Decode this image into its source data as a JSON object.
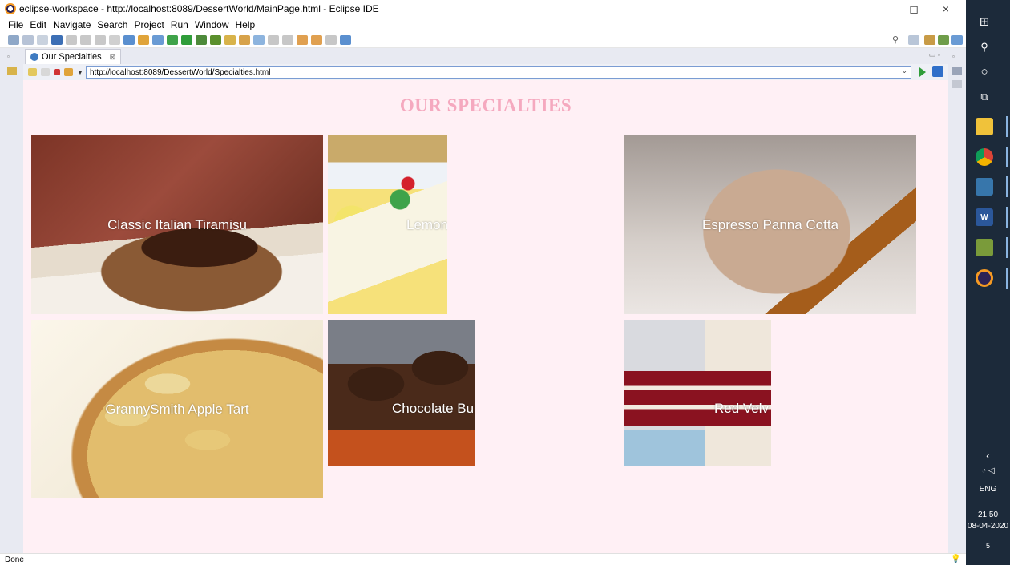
{
  "window": {
    "title": "eclipse-workspace - http://localhost:8089/DessertWorld/MainPage.html - Eclipse IDE",
    "minimize_glyph": "–",
    "maximize_glyph": "◻",
    "close_glyph": "×"
  },
  "menu": [
    "File",
    "Edit",
    "Navigate",
    "Search",
    "Project",
    "Run",
    "Window",
    "Help"
  ],
  "editor_tab": {
    "label": "Our Specialties",
    "close_glyph": "⊠"
  },
  "browser": {
    "url": "http://localhost:8089/DessertWorld/Specialties.html"
  },
  "page": {
    "heading": "OUR SPECIALTIES",
    "items": [
      {
        "caption": "Classic Italian Tiramisu"
      },
      {
        "caption": "Lemon"
      },
      {
        "caption": "Espresso Panna Cotta"
      },
      {
        "caption": "GrannySmith Apple Tart"
      },
      {
        "caption": "Chocolate Bu"
      },
      {
        "caption": "Red Velv"
      }
    ]
  },
  "status": {
    "text": "Done"
  },
  "taskbar": {
    "language": "ENG",
    "time": "21:50",
    "date": "08-04-2020",
    "notifications": "5"
  },
  "colors": {
    "page_background": "#fff0f5",
    "heading": "#f5a9bf",
    "taskbar": "#1c2a3a"
  }
}
